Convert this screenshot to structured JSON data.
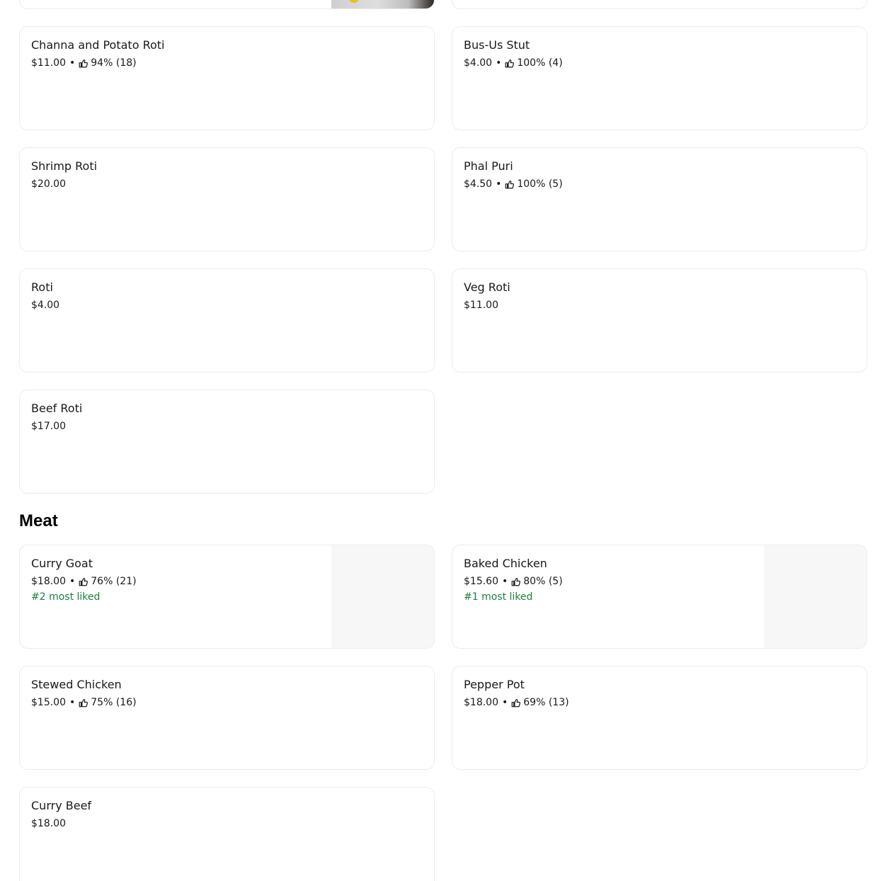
{
  "prev_section": {
    "cards": [
      {
        "name": "",
        "has_photo": true,
        "photo_icon": "food-photo"
      },
      {
        "name": ""
      }
    ]
  },
  "roti_section": {
    "items": [
      {
        "name": "Channa and Potato Roti",
        "price": "$11.00",
        "rating": "94% (18)"
      },
      {
        "name": "Bus-Us Stut",
        "price": "$4.00",
        "rating": "100% (4)"
      },
      {
        "name": "Shrimp Roti",
        "price": "$20.00"
      },
      {
        "name": "Phal Puri",
        "price": "$4.50",
        "rating": "100% (5)"
      },
      {
        "name": "Roti",
        "price": "$4.00"
      },
      {
        "name": "Veg Roti",
        "price": "$11.00"
      },
      {
        "name": "Beef Roti",
        "price": "$17.00"
      }
    ]
  },
  "meat_section": {
    "title": "Meat",
    "items": [
      {
        "name": "Curry Goat",
        "price": "$18.00",
        "rating": "76% (21)",
        "badge": "#2 most liked",
        "has_image": true
      },
      {
        "name": "Baked Chicken",
        "price": "$15.60",
        "rating": "80% (5)",
        "badge": "#1 most liked",
        "has_image": true
      },
      {
        "name": "Stewed Chicken",
        "price": "$15.00",
        "rating": "75% (16)"
      },
      {
        "name": "Pepper Pot",
        "price": "$18.00",
        "rating": "69% (13)"
      },
      {
        "name": "Curry Beef",
        "price": "$18.00"
      }
    ]
  },
  "separator": "•",
  "icons": {
    "rating": "thumbs-up-icon"
  },
  "colors": {
    "badge": "#1c7f3e",
    "card_border": "#ececec",
    "image_placeholder": "#f7f7f7"
  }
}
